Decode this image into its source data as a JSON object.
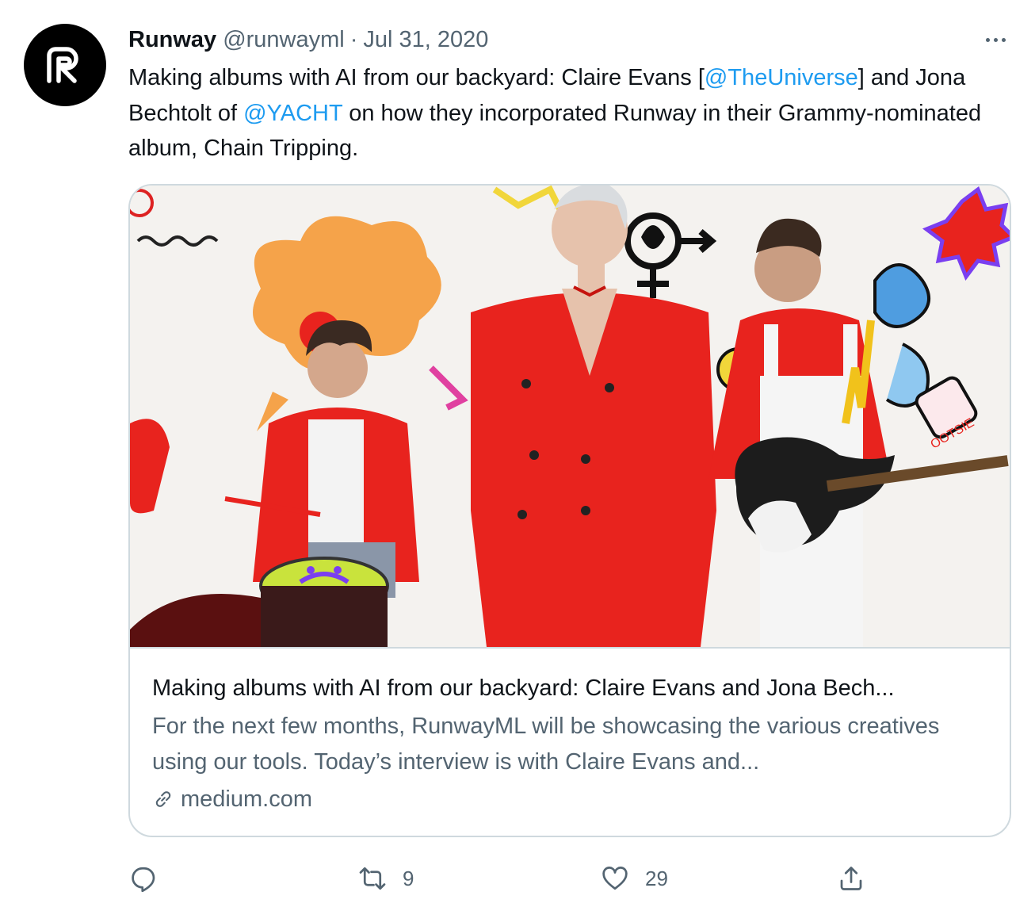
{
  "tweet": {
    "display_name": "Runway",
    "handle": "@runwayml",
    "separator": "·",
    "date": "Jul 31, 2020",
    "text": {
      "part1": "Making albums with AI from our backyard: Claire Evans [",
      "mention1": "@TheUniverse",
      "part2": "] and Jona Bechtolt of ",
      "mention2": "@YACHT",
      "part3": " on how they incorporated Runway in their Grammy-nominated album, Chain Tripping."
    }
  },
  "card": {
    "title": "Making albums with AI from our backyard: Claire Evans and Jona Bech...",
    "description": "For the next few months, RunwayML will be showcasing the various creatives using our tools. Today’s interview is with Claire Evans and...",
    "domain": "medium.com",
    "image_sign_text": "OOTSIE"
  },
  "actions": {
    "reply_count": "",
    "retweet_count": "9",
    "like_count": "29"
  },
  "icons": {
    "avatar": "runway-logo-icon",
    "more": "more-dots-icon",
    "link": "link-icon",
    "reply": "reply-icon",
    "retweet": "retweet-icon",
    "like": "heart-icon",
    "share": "share-icon"
  },
  "colors": {
    "link": "#1d9bf0",
    "secondary_text": "#536471",
    "border": "#cfd9de",
    "accent_red": "#e8231e"
  }
}
